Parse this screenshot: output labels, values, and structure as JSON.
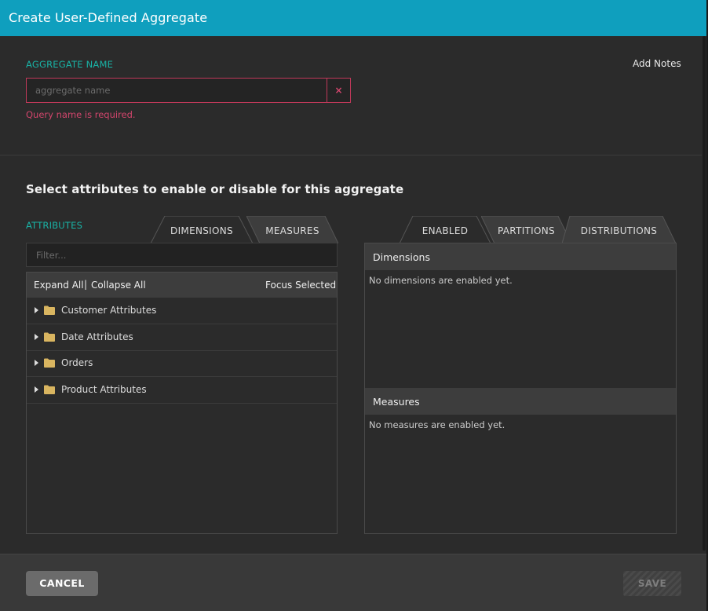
{
  "dialog": {
    "title": "Create User-Defined Aggregate"
  },
  "aggregate": {
    "label": "AGGREGATE NAME",
    "placeholder": "aggregate name",
    "value": "",
    "error": "Query name is required.",
    "clear_symbol": "×",
    "add_notes": "Add Notes"
  },
  "attributes_section": {
    "heading": "Select attributes to enable or disable for this aggregate",
    "label": "ATTRIBUTES",
    "tabs": [
      "DIMENSIONS",
      "MEASURES"
    ],
    "active_tab": "MEASURES",
    "filter_placeholder": "Filter...",
    "toolbar": {
      "expand_all": "Expand All",
      "separator": "|",
      "collapse_all": "Collapse All",
      "focus_selected": "Focus Selected"
    },
    "tree_items": [
      {
        "label": "Customer Attributes",
        "icon": "folder-icon"
      },
      {
        "label": "Date Attributes",
        "icon": "folder-icon"
      },
      {
        "label": "Orders",
        "icon": "folder-icon"
      },
      {
        "label": "Product Attributes",
        "icon": "folder-icon"
      }
    ]
  },
  "enabled_section": {
    "tabs": [
      "ENABLED",
      "PARTITIONS",
      "DISTRIBUTIONS"
    ],
    "active_tab": "ENABLED",
    "dimensions_header": "Dimensions",
    "dimensions_empty": "No dimensions are enabled yet.",
    "measures_header": "Measures",
    "measures_empty": "No measures are enabled yet."
  },
  "footer": {
    "cancel_label": "CANCEL",
    "save_label": "SAVE"
  },
  "colors": {
    "title_bar": "#0f9fbe",
    "accent_label": "#19b3a6",
    "error": "#d1456c",
    "folder": "#d9b560"
  }
}
